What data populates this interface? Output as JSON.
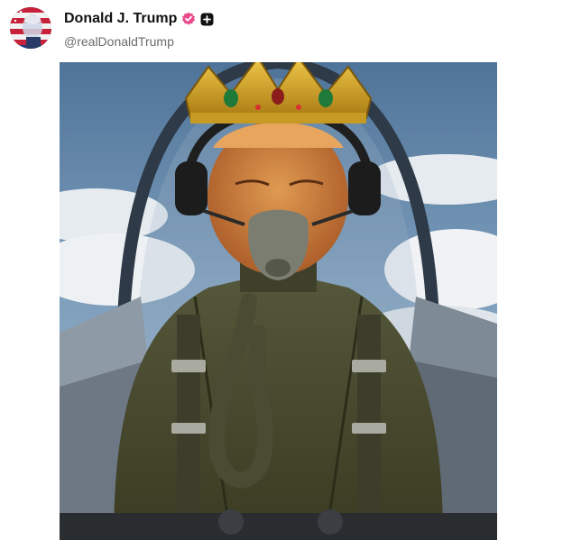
{
  "post": {
    "author": {
      "display_name": "Donald J. Trump",
      "handle": "@realDonaldTrump",
      "verified_color": "#e84a8b"
    },
    "icons": {
      "avatar": "avatar",
      "verified": "verified-badge-icon",
      "plus": "plus-icon"
    }
  },
  "colors": {
    "sky": "#6f93b6",
    "cloud": "#e9edf1",
    "jacket": "#4b4c2c",
    "crown": "#d4a526",
    "face": "#c97a3a"
  }
}
